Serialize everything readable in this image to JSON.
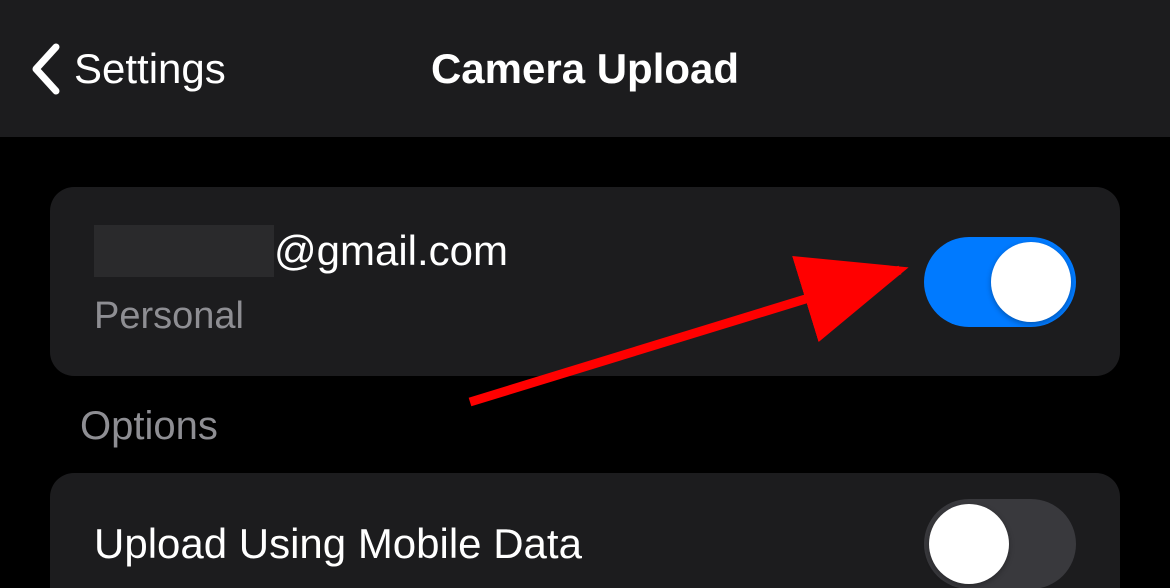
{
  "nav": {
    "back_label": "Settings",
    "title": "Camera Upload"
  },
  "account": {
    "email_domain": "@gmail.com",
    "type_label": "Personal",
    "toggle_on": true
  },
  "options": {
    "section_header": "Options",
    "mobile_data_label": "Upload Using Mobile Data",
    "mobile_data_toggle_on": false
  },
  "annotation": {
    "arrow_color": "#ff0000"
  }
}
